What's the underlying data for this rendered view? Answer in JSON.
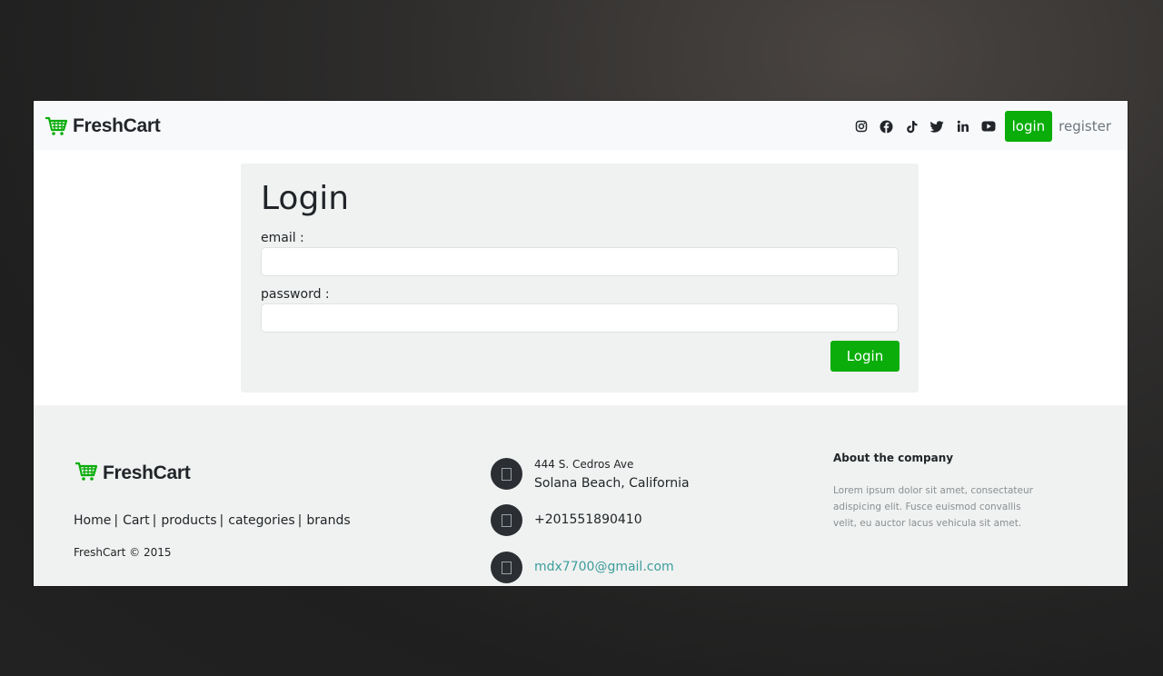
{
  "brand": {
    "name": "FreshCart",
    "accent": "#0aad0a"
  },
  "nav": {
    "social_icons": [
      "instagram-icon",
      "facebook-icon",
      "tiktok-icon",
      "twitter-icon",
      "linkedin-icon",
      "youtube-icon"
    ],
    "login_label": "login",
    "register_label": "register"
  },
  "login_form": {
    "title": "Login",
    "email_label": "email :",
    "email_value": "",
    "password_label": "password :",
    "password_value": "",
    "submit_label": "Login"
  },
  "footer": {
    "brand_name": "FreshCart",
    "links": [
      "Home",
      "Cart",
      "products",
      "categories",
      "brands"
    ],
    "copyright": "FreshCart © 2015",
    "address_line1": "444 S. Cedros Ave",
    "address_line2": "Solana Beach, California",
    "phone": "+201551890410",
    "email": "mdx7700@gmail.com",
    "about_title": "About the company",
    "about_text": "Lorem ipsum dolor sit amet, consectateur adispicing elit. Fusce euismod convallis velit, eu auctor lacus vehicula sit amet."
  }
}
